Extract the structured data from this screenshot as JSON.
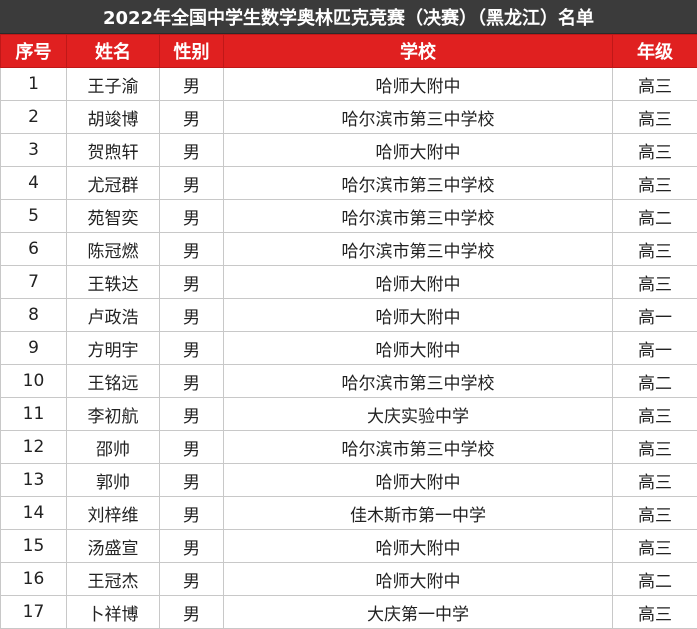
{
  "title": "2022年全国中学生数学奥林匹克竞赛（决赛）（黑龙江）名单",
  "colors": {
    "title_background": "#3b3b3b",
    "header_background": "#e02020",
    "header_text": "#ffffff",
    "grid_line": "#c8c8c8"
  },
  "columns": [
    "序号",
    "姓名",
    "性别",
    "学校",
    "年级"
  ],
  "rows": [
    {
      "no": "1",
      "name": "王子渝",
      "gender": "男",
      "school": "哈师大附中",
      "grade": "高三"
    },
    {
      "no": "2",
      "name": "胡竣博",
      "gender": "男",
      "school": "哈尔滨市第三中学校",
      "grade": "高三"
    },
    {
      "no": "3",
      "name": "贺煦轩",
      "gender": "男",
      "school": "哈师大附中",
      "grade": "高三"
    },
    {
      "no": "4",
      "name": "尤冠群",
      "gender": "男",
      "school": "哈尔滨市第三中学校",
      "grade": "高三"
    },
    {
      "no": "5",
      "name": "苑智奕",
      "gender": "男",
      "school": "哈尔滨市第三中学校",
      "grade": "高二"
    },
    {
      "no": "6",
      "name": "陈冠燃",
      "gender": "男",
      "school": "哈尔滨市第三中学校",
      "grade": "高三"
    },
    {
      "no": "7",
      "name": "王轶达",
      "gender": "男",
      "school": "哈师大附中",
      "grade": "高三"
    },
    {
      "no": "8",
      "name": "卢政浩",
      "gender": "男",
      "school": "哈师大附中",
      "grade": "高一"
    },
    {
      "no": "9",
      "name": "方明宇",
      "gender": "男",
      "school": "哈师大附中",
      "grade": "高一"
    },
    {
      "no": "10",
      "name": "王铭远",
      "gender": "男",
      "school": "哈尔滨市第三中学校",
      "grade": "高二"
    },
    {
      "no": "11",
      "name": "李初航",
      "gender": "男",
      "school": "大庆实验中学",
      "grade": "高三"
    },
    {
      "no": "12",
      "name": "邵帅",
      "gender": "男",
      "school": "哈尔滨市第三中学校",
      "grade": "高三"
    },
    {
      "no": "13",
      "name": "郭帅",
      "gender": "男",
      "school": "哈师大附中",
      "grade": "高三"
    },
    {
      "no": "14",
      "name": "刘梓维",
      "gender": "男",
      "school": "佳木斯市第一中学",
      "grade": "高三"
    },
    {
      "no": "15",
      "name": "汤盛宣",
      "gender": "男",
      "school": "哈师大附中",
      "grade": "高三"
    },
    {
      "no": "16",
      "name": "王冠杰",
      "gender": "男",
      "school": "哈师大附中",
      "grade": "高二"
    },
    {
      "no": "17",
      "name": "卜祥博",
      "gender": "男",
      "school": "大庆第一中学",
      "grade": "高三"
    }
  ]
}
